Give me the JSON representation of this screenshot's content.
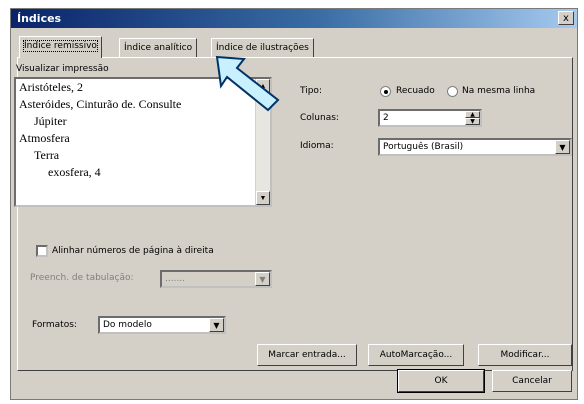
{
  "window": {
    "title": "Índices",
    "close": "x"
  },
  "tabs": [
    {
      "label": "Índice remissivo",
      "active": true
    },
    {
      "label": "Índice analítico",
      "active": false
    },
    {
      "label": "Índice de ilustrações",
      "active": false
    }
  ],
  "preview": {
    "label": "Visualizar impressão",
    "lines": [
      "Aristóteles, 2",
      "Asteróides, Cinturão de. Consulte",
      "Júpiter",
      "Atmosfera",
      "Terra",
      "exosfera, 4"
    ]
  },
  "tipo": {
    "label": "Tipo:",
    "options": [
      {
        "label": "Recuado",
        "selected": true
      },
      {
        "label": "Na mesma linha",
        "selected": false
      }
    ]
  },
  "colunas": {
    "label": "Colunas:",
    "value": "2"
  },
  "idioma": {
    "label": "Idioma:",
    "value": "Português (Brasil)"
  },
  "align_right": {
    "label": "Alinhar números de página à direita",
    "checked": false
  },
  "preenchimento": {
    "label": "Preench. de tabulação:",
    "value": "......."
  },
  "formatos": {
    "label": "Formatos:",
    "value": "Do modelo"
  },
  "buttons": {
    "marcar_entrada": "Marcar entrada...",
    "automarcacao": "AutoMarcação...",
    "modificar": "Modificar...",
    "ok": "OK",
    "cancelar": "Cancelar"
  },
  "colors": {
    "titlebar_start": "#0a246a",
    "titlebar_end": "#a6caf0",
    "dialog_face": "#d4d0c8",
    "arrow_fill": "#c8f0ff",
    "arrow_stroke": "#003366"
  },
  "icons": {
    "pointer": "arrow-icon",
    "dropdown": "chevron-down-icon"
  }
}
